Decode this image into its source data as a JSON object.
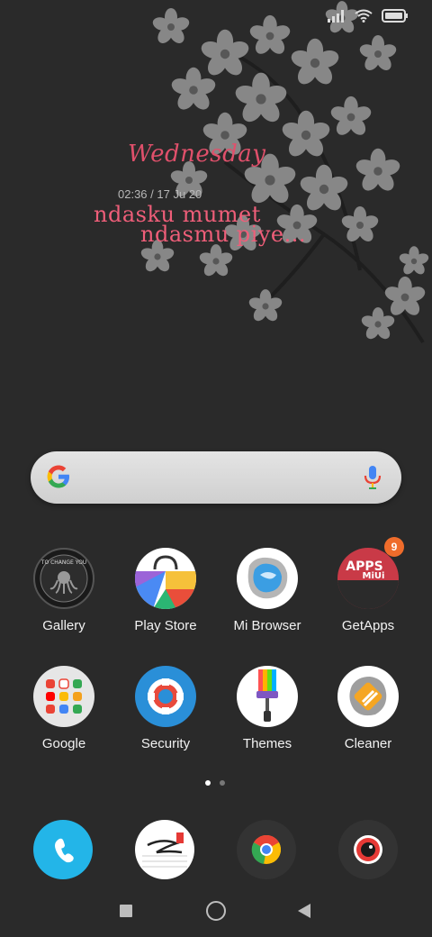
{
  "widget": {
    "weekday": "Wednesday",
    "datetime": "02:36 / 17 Ju   20",
    "quote_line1": "ndasku mumet",
    "quote_line2": "ndasmu piye..."
  },
  "notification_badges": {
    "getapps": "9"
  },
  "apps": [
    {
      "label": "Gallery"
    },
    {
      "label": "Play Store"
    },
    {
      "label": "Mi Browser"
    },
    {
      "label": "GetApps"
    },
    {
      "label": "Google"
    },
    {
      "label": "Security"
    },
    {
      "label": "Themes"
    },
    {
      "label": "Cleaner"
    }
  ],
  "icon_text": {
    "gallery_ring": "TO CHANGE YOU",
    "getapps_logo_1": "APPS",
    "getapps_logo_2": "MiUi"
  },
  "page_indicator": {
    "count": 2,
    "active": 1
  },
  "dock": [
    "phone-icon",
    "notes-icon",
    "chrome-icon",
    "camera-icon"
  ],
  "colors": {
    "accent_pink": "#e0506b",
    "dock_phone": "#23b5e8",
    "badge": "#ef6c2b"
  }
}
